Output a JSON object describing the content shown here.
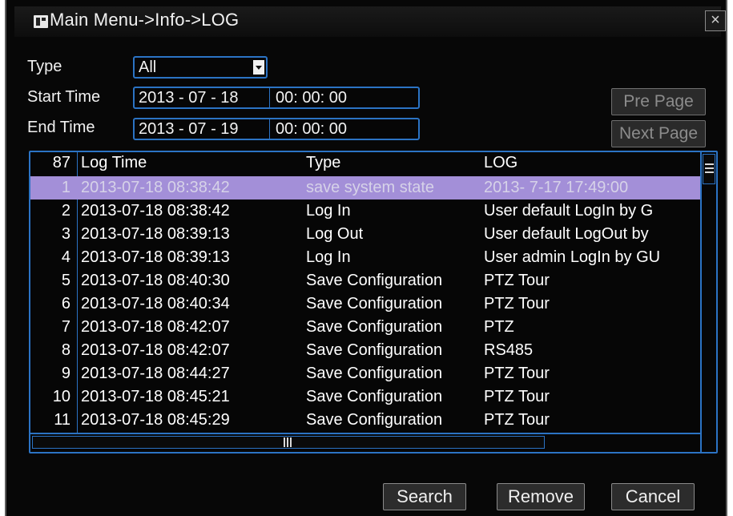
{
  "window": {
    "title": "Main Menu->Info->LOG",
    "close_label": "×"
  },
  "filters": {
    "type_label": "Type",
    "type_value": "All",
    "start_label": "Start Time",
    "start_date": "2013 - 07 - 18",
    "start_time": "00: 00: 00",
    "end_label": "End Time",
    "end_date": "2013 - 07 - 19",
    "end_time": "00: 00: 00"
  },
  "paging": {
    "pre_page": "Pre Page",
    "next_page": "Next Page"
  },
  "table": {
    "count": "87",
    "headers": {
      "time": "Log Time",
      "type": "Type",
      "log": "LOG"
    },
    "rows": [
      {
        "num": "1",
        "time": "2013-07-18 08:38:42",
        "type": "save system state",
        "log": "2013- 7-17 17:49:00"
      },
      {
        "num": "2",
        "time": "2013-07-18 08:38:42",
        "type": "Log In",
        "log": "User default LogIn by G"
      },
      {
        "num": "3",
        "time": "2013-07-18 08:39:13",
        "type": "Log Out",
        "log": "User default LogOut by"
      },
      {
        "num": "4",
        "time": "2013-07-18 08:39:13",
        "type": "Log In",
        "log": "User admin LogIn by GU"
      },
      {
        "num": "5",
        "time": "2013-07-18 08:40:30",
        "type": "Save Configuration",
        "log": "PTZ Tour"
      },
      {
        "num": "6",
        "time": "2013-07-18 08:40:34",
        "type": "Save Configuration",
        "log": "PTZ Tour"
      },
      {
        "num": "7",
        "time": "2013-07-18 08:42:07",
        "type": "Save Configuration",
        "log": "PTZ"
      },
      {
        "num": "8",
        "time": "2013-07-18 08:42:07",
        "type": "Save Configuration",
        "log": "RS485"
      },
      {
        "num": "9",
        "time": "2013-07-18 08:44:27",
        "type": "Save Configuration",
        "log": "PTZ Tour"
      },
      {
        "num": "10",
        "time": "2013-07-18 08:45:21",
        "type": "Save Configuration",
        "log": "PTZ Tour"
      },
      {
        "num": "11",
        "time": "2013-07-18 08:45:29",
        "type": "Save Configuration",
        "log": "PTZ Tour"
      }
    ]
  },
  "actions": {
    "search": "Search",
    "remove": "Remove",
    "cancel": "Cancel"
  },
  "colors": {
    "accent": "#2b73c4",
    "selected_row": "#a38fd8"
  }
}
